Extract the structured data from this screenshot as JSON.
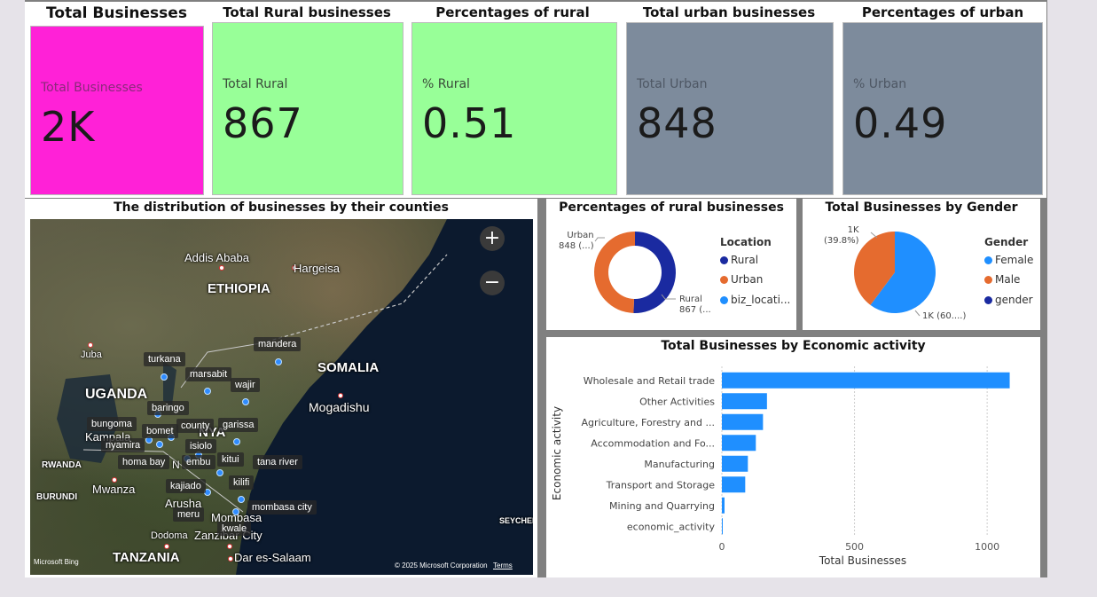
{
  "kpis": [
    {
      "title": "Total Businesses",
      "label": "Total Businesses",
      "value": "2K",
      "color": "#ff21d7"
    },
    {
      "title": "Total Rural businesses",
      "label": "Total Rural",
      "value": "867",
      "color": "#98ff98"
    },
    {
      "title": "Percentages of rural businesses",
      "label": "% Rural",
      "value": "0.51",
      "color": "#98ff98"
    },
    {
      "title": "Total urban businesses",
      "label": "Total Urban",
      "value": "848",
      "color": "#7d8b9c"
    },
    {
      "title": "Percentages of urban businesses",
      "label": "% Urban",
      "value": "0.49",
      "color": "#7d8b9c"
    }
  ],
  "map": {
    "title": "The distribution of businesses by their counties",
    "zoom_in": "+",
    "zoom_out": "−",
    "places": {
      "addis": "Addis Ababa",
      "ethiopia": "ETHIOPIA",
      "hargeisa": "Hargeisa",
      "somalia": "SOMALIA",
      "mogadishu": "Mogadishu",
      "juba": "Juba",
      "uganda": "UGANDA",
      "kampala": "Kampala",
      "rwanda": "RWANDA",
      "burundi": "BURUNDI",
      "mwanza": "Mwanza",
      "kenya": "NYA",
      "arusha": "Arusha",
      "mombasa": "Mombasa",
      "zanzibar": "Zanzibar City",
      "dodoma": "Dodoma",
      "tanzania": "TANZANIA",
      "dar": "Dar es-Salaam",
      "nairobi": "N",
      "seychelles": "SEYCHELL"
    },
    "counties": {
      "mandera": "mandera",
      "turkana": "turkana",
      "marsabit": "marsabit",
      "wajir": "wajir",
      "baringo": "baringo",
      "bungoma": "bungoma",
      "bomet": "bomet",
      "county": "county",
      "garissa": "garissa",
      "nyamira": "nyamira",
      "isiolo": "isiolo",
      "homabay": "homa bay",
      "embu": "embu",
      "kitui": "kitui",
      "tanariver": "tana river",
      "kajiado": "kajiado",
      "kilifi": "kilifi",
      "mombasacity": "mombasa city",
      "meru": "meru",
      "kwale": "kwale"
    },
    "attribution": "Microsoft Bing",
    "copyright": "© 2025 Microsoft Corporation",
    "terms": "Terms"
  },
  "rural_pie": {
    "title": "Percentages of rural businesses",
    "legend_title": "Location",
    "legend": [
      {
        "name": "Rural",
        "color": "#1a2aa0"
      },
      {
        "name": "Urban",
        "color": "#e56b2f"
      },
      {
        "name": "biz_locati...",
        "color": "#1f8fff"
      }
    ],
    "label_urban": "Urban\n848 (...)",
    "label_rural": "Rural\n867 (..."
  },
  "gender_pie": {
    "title": "Total Businesses by Gender",
    "legend_title": "Gender",
    "legend": [
      {
        "name": "Female",
        "color": "#1f8fff"
      },
      {
        "name": "Male",
        "color": "#e56b2f"
      },
      {
        "name": "gender",
        "color": "#1a2aa0"
      }
    ],
    "label_male": "1K\n(39.8%)",
    "label_female": "1K (60....)"
  },
  "chart_data": [
    {
      "type": "pie",
      "title": "Percentages of rural businesses",
      "categories": [
        "Rural",
        "Urban"
      ],
      "values": [
        867,
        848
      ],
      "donut": true
    },
    {
      "type": "pie",
      "title": "Total Businesses by Gender",
      "categories": [
        "Female",
        "Male"
      ],
      "values": [
        60.2,
        39.8
      ]
    },
    {
      "type": "bar",
      "orientation": "horizontal",
      "title": "Total Businesses by Economic activity",
      "xlabel": "Total Businesses",
      "ylabel": "Economic activity",
      "categories": [
        "Wholesale and Retail trade",
        "Other Activities",
        "Agriculture, Forestry and ...",
        "Accommodation and Fo...",
        "Manufacturing",
        "Transport and Storage",
        "Mining and Quarrying",
        "economic_activity"
      ],
      "values": [
        1085,
        170,
        155,
        128,
        98,
        88,
        10,
        2
      ],
      "xlim": [
        0,
        1150
      ],
      "xticks": [
        0,
        500,
        1000
      ],
      "grid": true,
      "color": "#1f8fff"
    }
  ]
}
